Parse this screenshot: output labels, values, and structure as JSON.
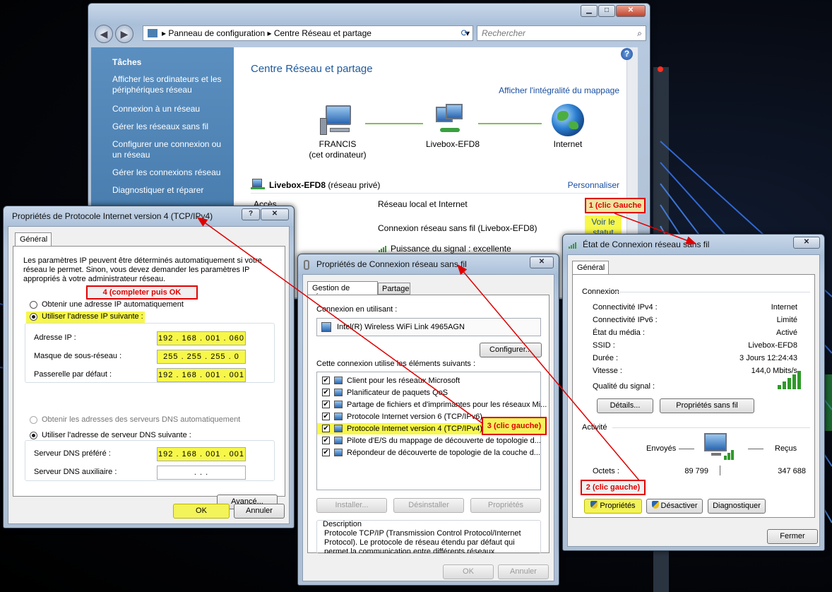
{
  "control_panel": {
    "breadcrumb": [
      "Panneau de configuration",
      "Centre Réseau et partage"
    ],
    "search_placeholder": "Rechercher",
    "tasks_title": "Tâches",
    "tasks": [
      "Afficher les ordinateurs et les périphériques réseau",
      "Connexion à un réseau",
      "Gérer les réseaux sans fil",
      "Configurer une connexion ou un réseau",
      "Gérer les connexions réseau",
      "Diagnostiquer et réparer"
    ],
    "page_title": "Centre Réseau et partage",
    "full_map_link": "Afficher l'intégralité du mappage",
    "map": {
      "computer_name": "FRANCIS",
      "computer_sub": "(cet ordinateur)",
      "router_name": "Livebox-EFD8",
      "internet": "Internet"
    },
    "network_name": "Livebox-EFD8",
    "network_type": "(réseau privé)",
    "customize_link": "Personnaliser",
    "access_label": "Accès",
    "access_value": "Réseau local et Internet",
    "connection_value": "Connexion réseau sans fil (Livebox-EFD8)",
    "view_status": "Voir le statut",
    "signal": "Puissance du signal : excellente"
  },
  "ipv4_dialog": {
    "title": "Propriétés de Protocole Internet version 4 (TCP/IPv4)",
    "tab": "Général",
    "intro": "Les paramètres IP peuvent être déterminés automatiquement si votre réseau le permet. Sinon, vous devez demander les paramètres IP appropriés à votre administrateur réseau.",
    "auto_ip": "Obtenir une adresse IP automatiquement",
    "manual_ip": "Utiliser l'adresse IP suivante :",
    "ip_label": "Adresse IP :",
    "ip_value": "192 . 168 . 001 . 060",
    "mask_label": "Masque de sous-réseau :",
    "mask_value": "255 . 255 . 255 .   0",
    "gateway_label": "Passerelle par défaut :",
    "gateway_value": "192 . 168 . 001 . 001",
    "auto_dns": "Obtenir les adresses des serveurs DNS automatiquement",
    "manual_dns": "Utiliser l'adresse de serveur DNS suivante :",
    "dns1_label": "Serveur DNS préféré :",
    "dns1_value": "192 . 168 . 001 . 001",
    "dns2_label": "Serveur DNS auxiliaire :",
    "dns2_value": ".       .       .",
    "advanced": "Avancé...",
    "ok": "OK",
    "cancel": "Annuler"
  },
  "wifi_props": {
    "title": "Propriétés de Connexion réseau sans fil",
    "tab_network": "Gestion de réseau",
    "tab_sharing": "Partage",
    "connect_using": "Connexion en utilisant :",
    "adapter": "Intel(R) Wireless WiFi Link 4965AGN",
    "configure": "Configurer...",
    "items_label": "Cette connexion utilise les éléments suivants :",
    "items": [
      "Client pour les réseaux Microsoft",
      "Planificateur de paquets QoS",
      "Partage de fichiers et d'imprimantes pour les réseaux Mi...",
      "Protocole Internet version 6 (TCP/IPv6)",
      "Protocole Internet version 4 (TCP/IPv4)",
      "Pilote d'E/S du mappage de découverte de topologie d...",
      "Répondeur de découverte de topologie de la couche d..."
    ],
    "install": "Installer...",
    "uninstall": "Désinstaller",
    "properties": "Propriétés",
    "desc_title": "Description",
    "description": "Protocole TCP/IP (Transmission Control Protocol/Internet Protocol). Le protocole de réseau étendu par défaut qui permet la communication entre différents réseaux interconnectés.",
    "ok": "OK",
    "cancel": "Annuler"
  },
  "status_dialog": {
    "title": "État de Connexion réseau sans fil",
    "tab": "Général",
    "connection_title": "Connexion",
    "rows": [
      {
        "label": "Connectivité IPv4 :",
        "value": "Internet"
      },
      {
        "label": "Connectivité IPv6 :",
        "value": "Limité"
      },
      {
        "label": "État du média :",
        "value": "Activé"
      },
      {
        "label": "SSID :",
        "value": "Livebox-EFD8"
      },
      {
        "label": "Durée :",
        "value": "3 Jours 12:24:43"
      },
      {
        "label": "Vitesse :",
        "value": "144,0 Mbits/s"
      }
    ],
    "signal_quality": "Qualité du signal :",
    "details": "Détails...",
    "wireless_props": "Propriétés sans fil",
    "activity_title": "Activité",
    "sent": "Envoyés",
    "received": "Reçus",
    "bytes_label": "Octets :",
    "bytes_sent": "89 799",
    "bytes_received": "347 688",
    "properties": "Propriétés",
    "disable": "Désactiver",
    "diagnose": "Diagnostiquer",
    "close": "Fermer"
  },
  "annotations": {
    "step1": "1 (clic Gauche",
    "step2": "2 (clic gauche)",
    "step3": "3 (clic gauche)",
    "step4": "4 (completer puis OK"
  },
  "colors": {
    "highlight": "#f7f74a",
    "annotation_red": "#e00000",
    "sidebar_blue": "#4a7fb0",
    "link_blue": "#1a4fa0",
    "title_blue": "#1e5a9c"
  }
}
